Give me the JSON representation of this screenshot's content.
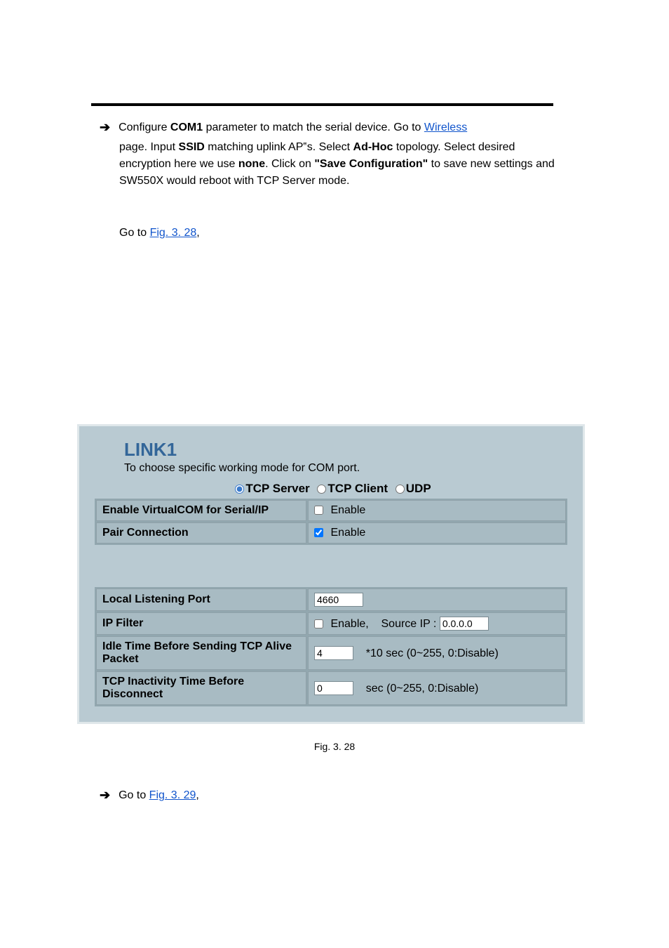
{
  "bulletArrow": "➔",
  "intro": {
    "lead1": "Configure ",
    "lead1_bold": "COM1 ",
    "lead1_rest": "parameter to match the serial device. Go to",
    "wirelessLinkLabel": " Wireless ",
    "wirelessRestA": "page. Input ",
    "wirelessRestA_bold1": "SSID",
    "wirelessRestB": " matching uplink AP‟s. Select ",
    "wirelessRestB_bold2": "Ad-Hoc",
    "wirelessRestC": " topology. Select desired encryption here we use ",
    "wirelessRestC_bold3": "none",
    "wirelessRestD": ". Click on ",
    "saveLabel": "\"Save Configuration\"",
    "wirelessRestE": " to save new settings and SW550X would reboot with TCP Server mode."
  },
  "figRefLead": "Go to ",
  "figRefLink": "Fig. 3. 28",
  "figRefTail": ",",
  "panel": {
    "title": "LINK1",
    "subtitle": "To choose specific working mode for COM port.",
    "modes": {
      "tcpServer": "TCP Server",
      "tcpClient": "TCP Client",
      "udp": "UDP"
    },
    "rows": {
      "enableVcom": "Enable VirtualCOM for Serial/IP",
      "pairConn": "Pair Connection",
      "localPort": "Local Listening Port",
      "ipFilter": "IP Filter",
      "idleAlive": "Idle Time Before Sending TCP Alive Packet",
      "tcpInact": "TCP Inactivity Time Before Disconnect"
    },
    "values": {
      "enableLabel": "Enable",
      "enableComma": "Enable,",
      "localPort": "4660",
      "sourceIpLabel": "Source IP :",
      "sourceIp": "0.0.0.0",
      "idleAlive": "4",
      "idleAliveSuffix": "*10 sec (0~255, 0:Disable)",
      "tcpInact": "0",
      "tcpInactSuffix": "sec (0~255, 0:Disable)"
    }
  },
  "figCaption": "Fig. 3. 28",
  "bottomBullet": {
    "lead": "Go to ",
    "link": "Fig. 3. 29",
    "tail": ","
  }
}
